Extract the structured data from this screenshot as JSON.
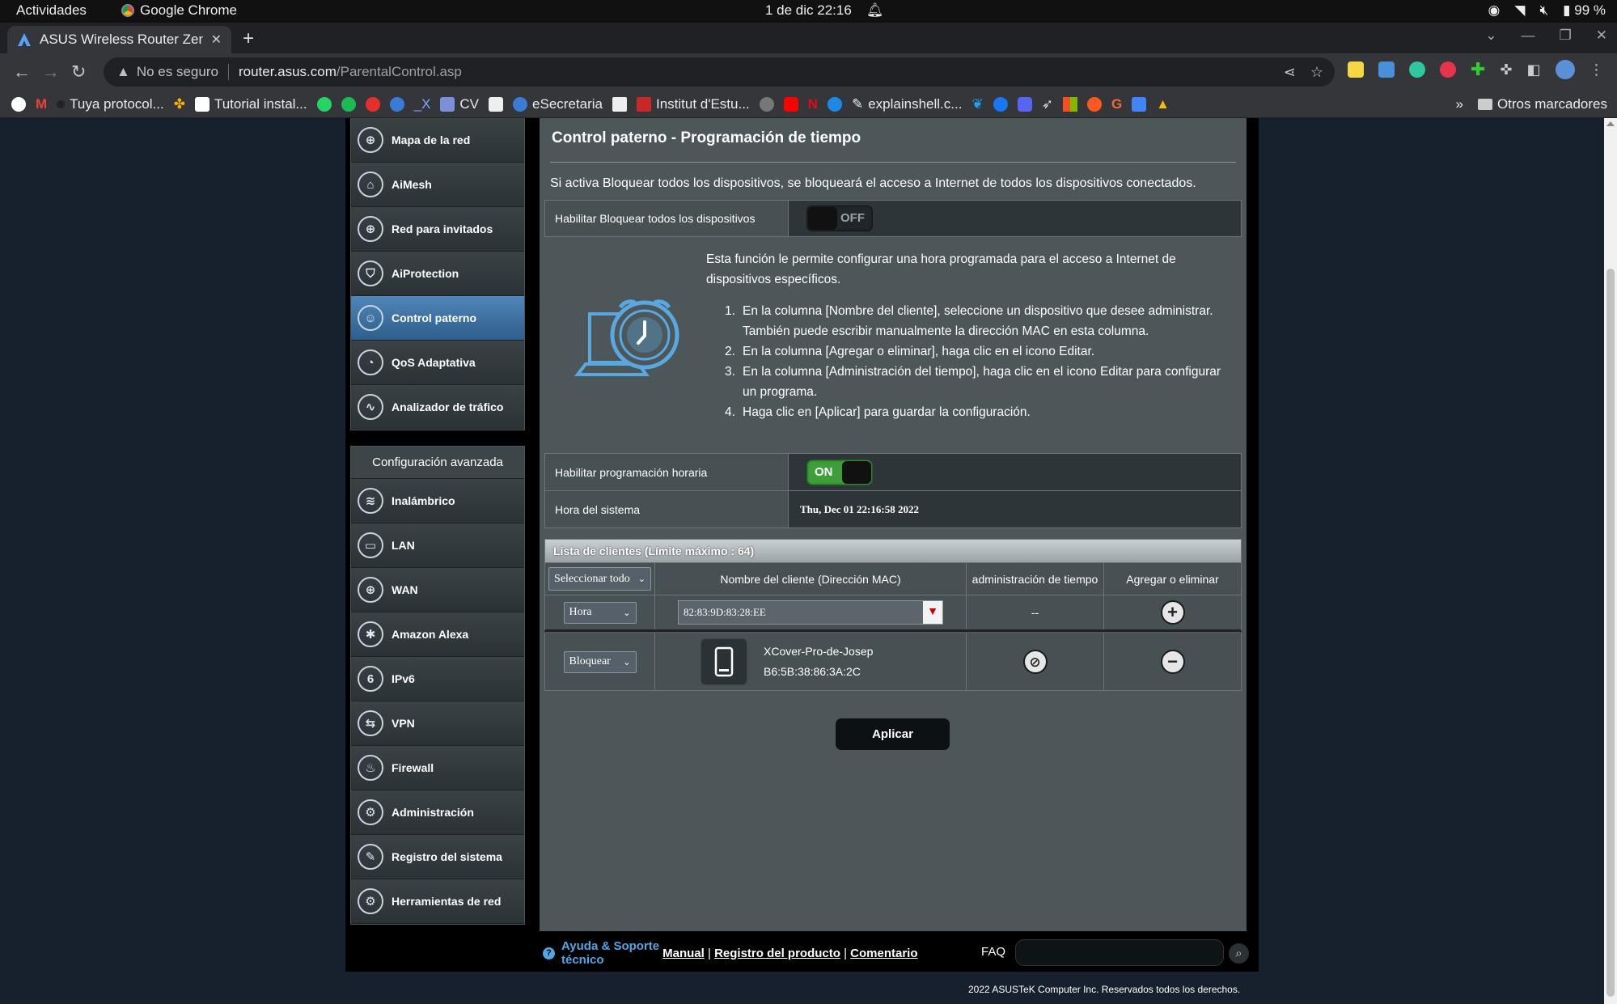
{
  "os_bar": {
    "activities": "Actividades",
    "app": "Google Chrome",
    "datetime": "1 de dic  22:16",
    "battery": "99 %"
  },
  "browser": {
    "tab_title": "ASUS Wireless Router Zen",
    "insecure": "No es seguro",
    "url_host": "router.asus.com",
    "url_path": "/ParentalControl.asp",
    "bookmarks": [
      "Tuya protocol...",
      "Tutorial instal...",
      "_X",
      "CV",
      "eSecretaria",
      "Institut d'Estu...",
      "explainshell.c..."
    ],
    "more_bookmarks": "»",
    "other_bookmarks": "Otros marcadores"
  },
  "sidebar": {
    "general_items": [
      {
        "label": "Mapa de la red",
        "icon": "network-map-icon",
        "glyph": "⊕"
      },
      {
        "label": "AiMesh",
        "icon": "aimesh-icon",
        "glyph": "⌂"
      },
      {
        "label": "Red para invitados",
        "icon": "guest-network-icon",
        "glyph": "⊕"
      },
      {
        "label": "AiProtection",
        "icon": "shield-lock-icon",
        "glyph": "⛉"
      },
      {
        "label": "Control paterno",
        "icon": "parental-control-icon",
        "glyph": "☺"
      },
      {
        "label": "QoS Adaptativa",
        "icon": "qos-gauge-icon",
        "glyph": "◔"
      },
      {
        "label": "Analizador de tráfico",
        "icon": "traffic-analyzer-icon",
        "glyph": "∿"
      }
    ],
    "advanced_header": "Configuración avanzada",
    "advanced_items": [
      {
        "label": "Inalámbrico",
        "icon": "wireless-icon",
        "glyph": "≋"
      },
      {
        "label": "LAN",
        "icon": "lan-icon",
        "glyph": "▭"
      },
      {
        "label": "WAN",
        "icon": "wan-globe-icon",
        "glyph": "⊕"
      },
      {
        "label": "Amazon Alexa",
        "icon": "alexa-icon",
        "glyph": "✱"
      },
      {
        "label": "IPv6",
        "icon": "ipv6-icon",
        "glyph": "6"
      },
      {
        "label": "VPN",
        "icon": "vpn-icon",
        "glyph": "⇆"
      },
      {
        "label": "Firewall",
        "icon": "firewall-icon",
        "glyph": "♨"
      },
      {
        "label": "Administración",
        "icon": "administration-icon",
        "glyph": "⚙"
      },
      {
        "label": "Registro del sistema",
        "icon": "system-log-icon",
        "glyph": "✎"
      },
      {
        "label": "Herramientas de red",
        "icon": "network-tools-icon",
        "glyph": "⚙"
      }
    ]
  },
  "content": {
    "title": "Control paterno - Programación de tiempo",
    "block_all_desc": "Si activa Bloquear todos los dispositivos, se bloqueará el acceso a Internet de todos los dispositivos conectados.",
    "block_all_label": "Habilitar Bloquear todos los dispositivos",
    "block_all_state": "OFF",
    "intro": "Esta función le permite configurar una hora programada para el acceso a Internet de dispositivos específicos.",
    "steps": [
      "En la columna [Nombre del cliente], seleccione un dispositivo que desee administrar. También puede escribir manualmente la dirección MAC en esta columna.",
      "En la columna [Agregar o eliminar], haga clic en el icono Editar.",
      "En la columna [Administración del tiempo], haga clic en el icono Editar para configurar un programa.",
      "Haga clic en [Aplicar] para guardar la configuración."
    ],
    "schedule_label": "Habilitar programación horaria",
    "schedule_state": "ON",
    "system_time_label": "Hora del sistema",
    "system_time_value": "Thu, Dec 01 22:16:58 2022",
    "client_list_title": "Lista de clientes (Límite máximo : 64)",
    "columns": {
      "select_all": "Seleccionar todo",
      "client_name": "Nombre del cliente (Dirección MAC)",
      "time_mgmt": "administración de tiempo",
      "add_remove": "Agregar o eliminar"
    },
    "new_row": {
      "mode": "Hora",
      "mac": "82:83:9D:83:28:EE",
      "time_mgmt": "--"
    },
    "client": {
      "mode": "Bloquear",
      "name": "XCover-Pro-de-Josep",
      "mac": "B6:5B:38:86:3A:2C"
    },
    "apply": "Aplicar"
  },
  "footer": {
    "help_line1": "Ayuda & Soporte",
    "help_line2": "técnico",
    "manual": "Manual",
    "registration": "Registro del producto",
    "comment": "Comentario",
    "faq": "FAQ",
    "copyright": "2022 ASUSTeK Computer Inc. Reservados todos los derechos."
  },
  "colors": {
    "active_menu": "#4f86b8",
    "toggle_on": "#3d9e3a",
    "link_blue": "#51a6e6"
  }
}
